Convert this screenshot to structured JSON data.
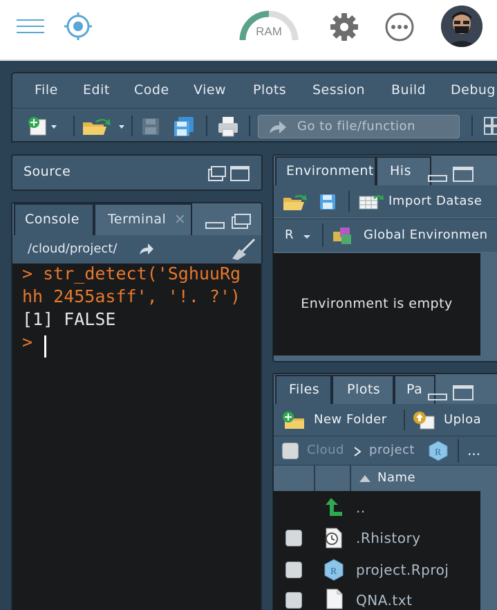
{
  "topbar": {
    "ram_label": "RAM",
    "icons": [
      "menu-icon",
      "target-icon",
      "ram-gauge-icon",
      "gear-icon",
      "more-icon",
      "avatar"
    ]
  },
  "menu": {
    "items": [
      "File",
      "Edit",
      "Code",
      "View",
      "Plots",
      "Session",
      "Build",
      "Debug"
    ]
  },
  "toolbar": {
    "goto_placeholder": "Go to file/function"
  },
  "source_pane": {
    "title": "Source"
  },
  "console_pane": {
    "tabs": [
      "Console",
      "Terminal"
    ],
    "path": "/cloud/project/",
    "lines": [
      {
        "prompt": "> ",
        "text": "str_detect('SghuuRg"
      },
      {
        "prompt": "",
        "text": "hh 2455asff', '!. ?')"
      },
      {
        "prompt": "",
        "text": "[1] FALSE"
      },
      {
        "prompt": "> ",
        "text": ""
      }
    ]
  },
  "env_pane": {
    "tabs": [
      "Environment",
      "His"
    ],
    "import_label": "Import Datase",
    "lang": "R",
    "scope": "Global Environmen",
    "empty_text": "Environment is empty"
  },
  "files_pane": {
    "tabs": [
      "Files",
      "Plots",
      "Pa"
    ],
    "new_folder": "New Folder",
    "upload": "Uploa",
    "breadcrumb": [
      "Cloud",
      "project"
    ],
    "more": "...",
    "column_name": "Name",
    "rows": [
      {
        "name": "..",
        "icon": "up-arrow-icon"
      },
      {
        "name": ".Rhistory",
        "icon": "history-file-icon"
      },
      {
        "name": "project.Rproj",
        "icon": "rproj-file-icon"
      },
      {
        "name": "QNA.txt",
        "icon": "text-file-icon"
      }
    ]
  },
  "colors": {
    "panel": "#3e586e",
    "console_bg": "#181a1c",
    "prompt": "#e8782c",
    "accent_blue": "#5aa7d6"
  }
}
